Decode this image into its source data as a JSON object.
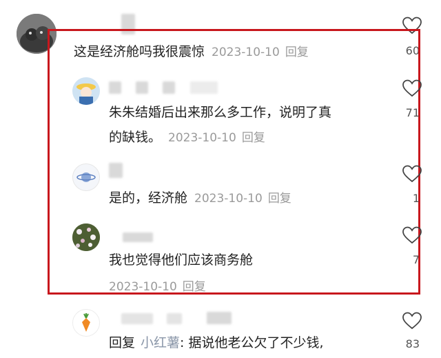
{
  "comments": [
    {
      "text": "这是经济舱吗我很震惊",
      "date": "2023-10-10",
      "reply_label": "回复",
      "likes": "60"
    }
  ],
  "replies": [
    {
      "text_line1": "朱朱结婚后出来那么多工作，说明了真",
      "text_line2": "的缺钱。",
      "date": "2023-10-10",
      "reply_label": "回复",
      "likes": "71"
    },
    {
      "text": "是的，经济舱",
      "date": "2023-10-10",
      "reply_label": "回复",
      "likes": "1"
    },
    {
      "text": "我也觉得他们应该商务舱",
      "date": "2023-10-10",
      "reply_label": "回复",
      "likes": "7"
    },
    {
      "reply_prefix": "回复",
      "mention": "小红薯",
      "text": ": 据说他老公欠了不少钱,",
      "likes": "83"
    }
  ],
  "icons": {
    "like": "heart-outline-icon",
    "avatar_1": "cat-avatar",
    "avatar_2": "girl-hat-avatar",
    "avatar_3": "planet-avatar",
    "avatar_4": "flowers-avatar",
    "avatar_5": "carrot-avatar"
  },
  "colors": {
    "highlight_box": "#c8171d",
    "meta": "#9a9a9a",
    "mention": "#8a96a8"
  }
}
